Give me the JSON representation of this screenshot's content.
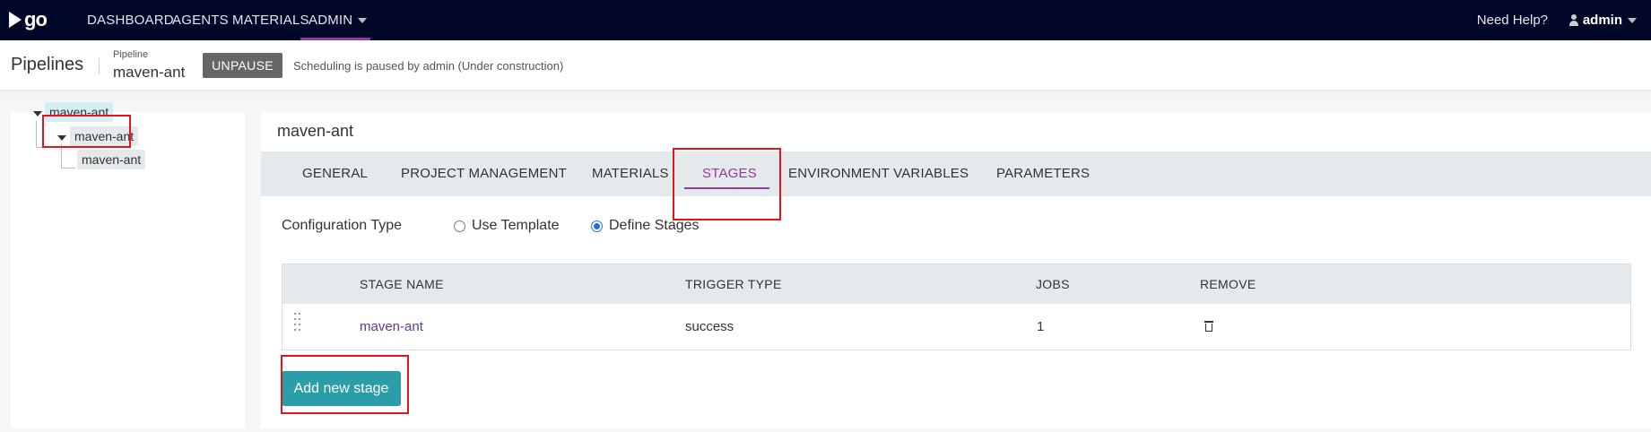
{
  "nav": {
    "logo_text": "go",
    "items": [
      {
        "label": "DASHBOARD"
      },
      {
        "label": "AGENTS"
      },
      {
        "label": "MATERIALS"
      },
      {
        "label": "ADMIN"
      }
    ],
    "help": "Need Help?",
    "user": "admin"
  },
  "subheader": {
    "section_title": "Pipelines",
    "pipeline_caption": "Pipeline",
    "pipeline_name": "maven-ant",
    "unpause_label": "UNPAUSE",
    "schedule_status": "Scheduling is paused by admin (Under construction)"
  },
  "tree": {
    "pipeline": "maven-ant",
    "stage": "maven-ant",
    "job": "maven-ant"
  },
  "main": {
    "title": "maven-ant",
    "tabs": [
      {
        "label": "GENERAL"
      },
      {
        "label": "PROJECT MANAGEMENT"
      },
      {
        "label": "MATERIALS"
      },
      {
        "label": "STAGES"
      },
      {
        "label": "ENVIRONMENT VARIABLES"
      },
      {
        "label": "PARAMETERS"
      }
    ],
    "active_tab": "STAGES",
    "config_type_label": "Configuration Type",
    "options": [
      {
        "label": "Use Template",
        "checked": false
      },
      {
        "label": "Define Stages",
        "checked": true
      }
    ],
    "table": {
      "headers": [
        "STAGE NAME",
        "TRIGGER TYPE",
        "JOBS",
        "REMOVE"
      ],
      "rows": [
        {
          "stage_name": "maven-ant",
          "trigger_type": "success",
          "jobs": "1"
        }
      ]
    },
    "add_button": "Add new stage"
  },
  "colors": {
    "nav_bg": "#000728",
    "accent_purple": "#943a9e",
    "button_teal": "#2a9ea8",
    "highlight_red": "#e3141b"
  }
}
